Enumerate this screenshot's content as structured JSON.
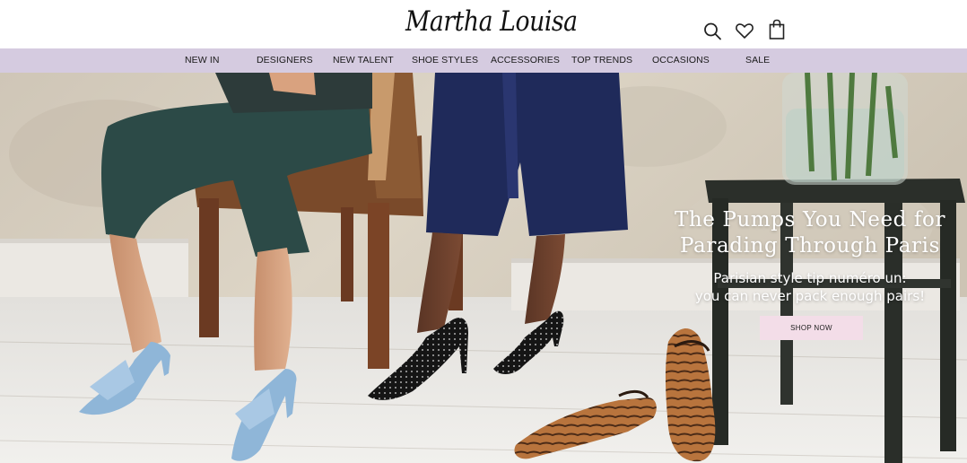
{
  "header": {
    "logo": "Martha Louisa",
    "icons": [
      "search-icon",
      "heart-icon",
      "shopping-bag-icon"
    ]
  },
  "nav": {
    "items": [
      {
        "label": "NEW IN"
      },
      {
        "label": "DESIGNERS"
      },
      {
        "label": "NEW TALENT"
      },
      {
        "label": "SHOE STYLES"
      },
      {
        "label": "ACCESSORIES"
      },
      {
        "label": "TOP TRENDS"
      },
      {
        "label": "OCCASIONS"
      },
      {
        "label": "SALE"
      }
    ]
  },
  "hero": {
    "title_line1": "The Pumps You Need for",
    "title_line2": "Parading Through Paris",
    "subtitle_line1": "Parisian style tip numéro un:",
    "subtitle_line2": "you can never pack enough pairs!",
    "cta_label": "SHOP NOW"
  },
  "colors": {
    "nav_background": "#d5cbe0",
    "cta_background": "#f3dde8",
    "header_background": "#ffffff"
  }
}
